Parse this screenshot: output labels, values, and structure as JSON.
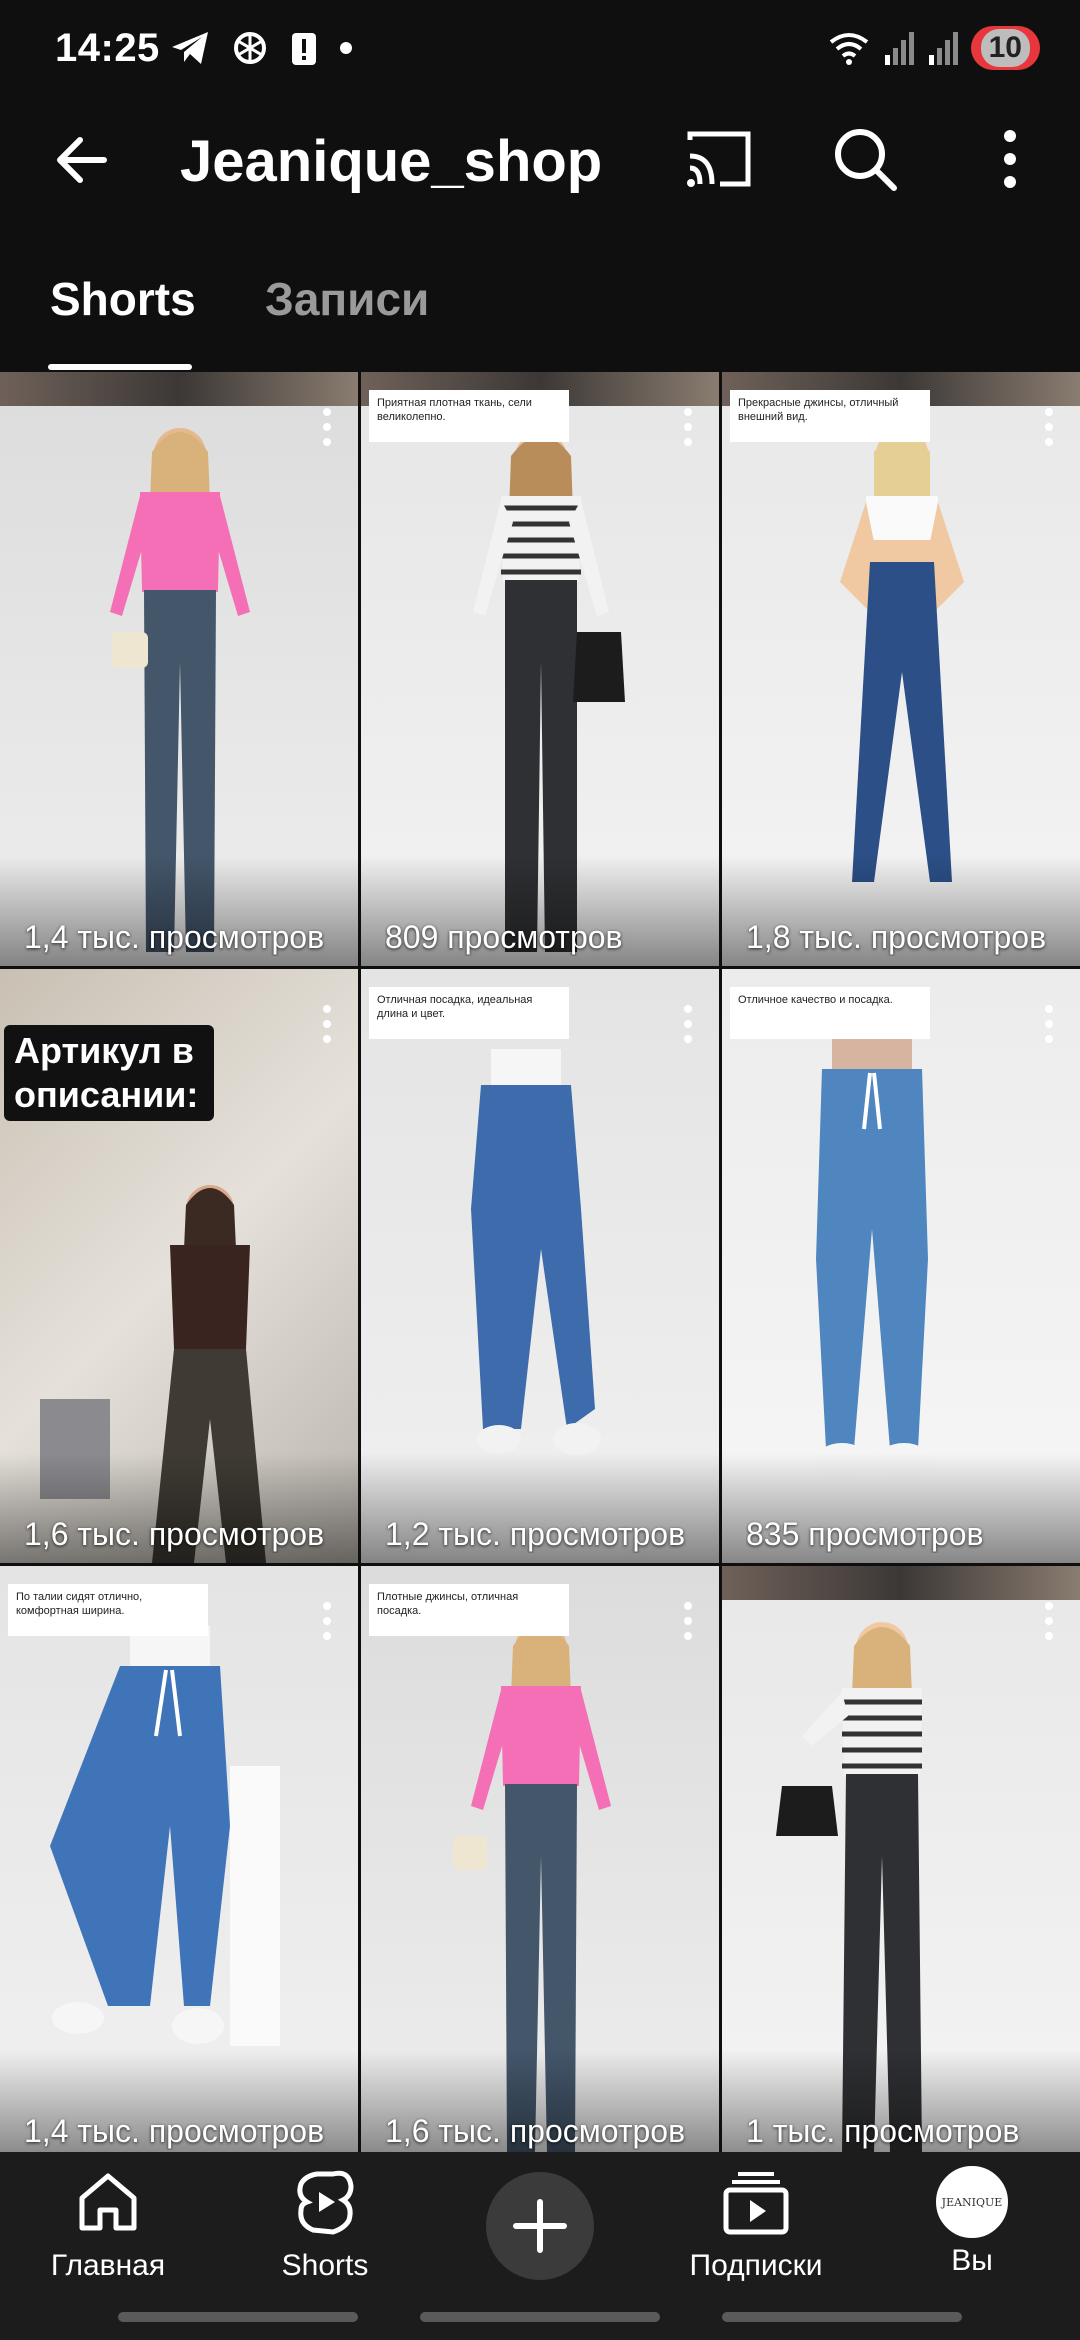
{
  "status_bar": {
    "time": "14:25",
    "notification_count": "10",
    "icons": [
      "telegram-icon",
      "chatgpt-icon",
      "alert-icon",
      "dot-icon",
      "wifi-icon",
      "signal-icon",
      "signal-icon"
    ]
  },
  "header": {
    "channel_name": "Jeanique_shop",
    "icons": [
      "back-arrow-icon",
      "cast-icon",
      "search-icon",
      "more-vertical-icon"
    ]
  },
  "tabs": [
    {
      "label": "Shorts",
      "active": true
    },
    {
      "label": "Записи",
      "active": false
    }
  ],
  "grid": [
    {
      "views": "1,4 тыс. просмотров",
      "caption": "",
      "overlay": ""
    },
    {
      "views": "809 просмотров",
      "caption": "Приятная плотная ткань, сели великолепно.",
      "overlay": ""
    },
    {
      "views": "1,8 тыс. просмотров",
      "caption": "Прекрасные джинсы, отличный внешний вид.",
      "overlay": ""
    },
    {
      "views": "1,6 тыс. просмотров",
      "caption": "",
      "overlay": "Артикул в описании:"
    },
    {
      "views": "1,2 тыс. просмотров",
      "caption": "Отличная посадка, идеальная длина и цвет.",
      "overlay": ""
    },
    {
      "views": "835 просмотров",
      "caption": "Отличное качество и посадка.",
      "overlay": ""
    },
    {
      "views": "1,4 тыс. просмотров",
      "caption": "По талии сидят отлично, комфортная ширина.",
      "overlay": ""
    },
    {
      "views": "1,6 тыс. просмотров",
      "caption": "Плотные джинсы, отличная посадка.",
      "overlay": ""
    },
    {
      "views": "1 тыс. просмотров",
      "caption": "",
      "overlay": ""
    }
  ],
  "bottom_nav": {
    "home": "Главная",
    "shorts": "Shorts",
    "subscriptions": "Подписки",
    "you": "Вы",
    "avatar_text": "JEANIQUE"
  },
  "colors": {
    "background": "#0f0f0f",
    "nav_background": "#1c1c1c",
    "badge": "#e7373c"
  }
}
